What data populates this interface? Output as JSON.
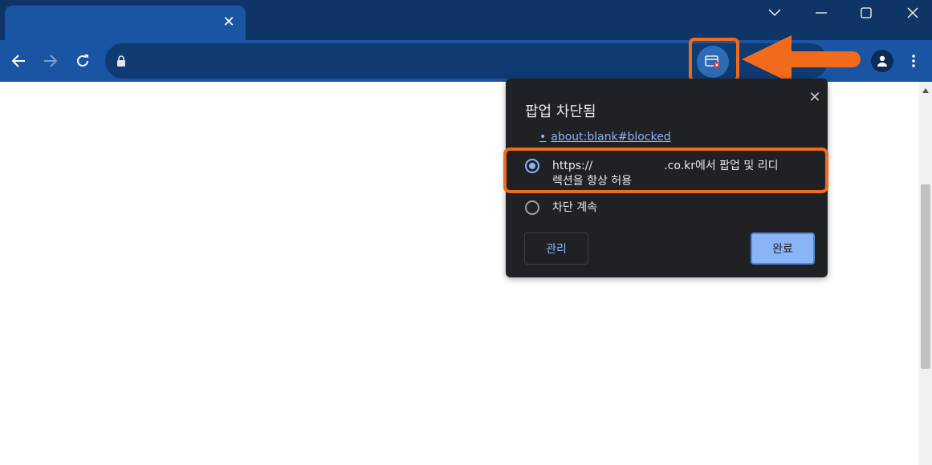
{
  "tab": {
    "title": "",
    "close_glyph": "✕"
  },
  "window_controls": [
    "chevron-down-icon",
    "minimize-icon",
    "maximize-icon",
    "close-icon"
  ],
  "toolbar": {
    "icons": [
      "back-arrow-icon",
      "forward-arrow-icon",
      "reload-icon",
      "lock-icon",
      "popup-blocked-icon",
      "profile-icon",
      "menu-dots-icon"
    ],
    "url": ""
  },
  "popup_bubble": {
    "title": "팝업 차단됨",
    "close_glyph": "✕",
    "blocked_link": "about:blank#blocked",
    "bullet": "•",
    "options": [
      {
        "line1": "https://                    .co.kr에서 팝업 및 리디",
        "line2": "렉션을 항상 허용",
        "selected": true
      },
      {
        "line1": "차단 계속",
        "line2": "",
        "selected": false
      }
    ],
    "manage_label": "관리",
    "done_label": "완료"
  },
  "colors": {
    "titlebar": "#0e3565",
    "toolbar": "#1a55a3",
    "highlight": "#f26a1b",
    "bubble_bg": "#202124",
    "link": "#8ab4f8"
  }
}
